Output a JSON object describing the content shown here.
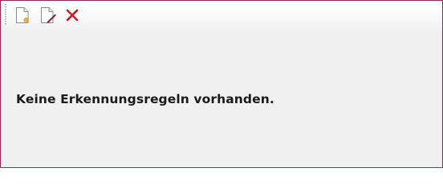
{
  "toolbar": {
    "buttons": [
      {
        "name": "new-rule-button",
        "icon": "new-document-icon"
      },
      {
        "name": "edit-rule-button",
        "icon": "edit-document-icon"
      },
      {
        "name": "delete-rule-button",
        "icon": "delete-x-icon"
      }
    ]
  },
  "main": {
    "empty_message": "Keine Erkennungsregeln vorhanden."
  },
  "colors": {
    "window_border": "#8a2c54",
    "background": "#f0f0f0",
    "delete_icon": "#c0141e",
    "edit_pencil": "#9b1f2e",
    "new_star": "#f0b020"
  }
}
